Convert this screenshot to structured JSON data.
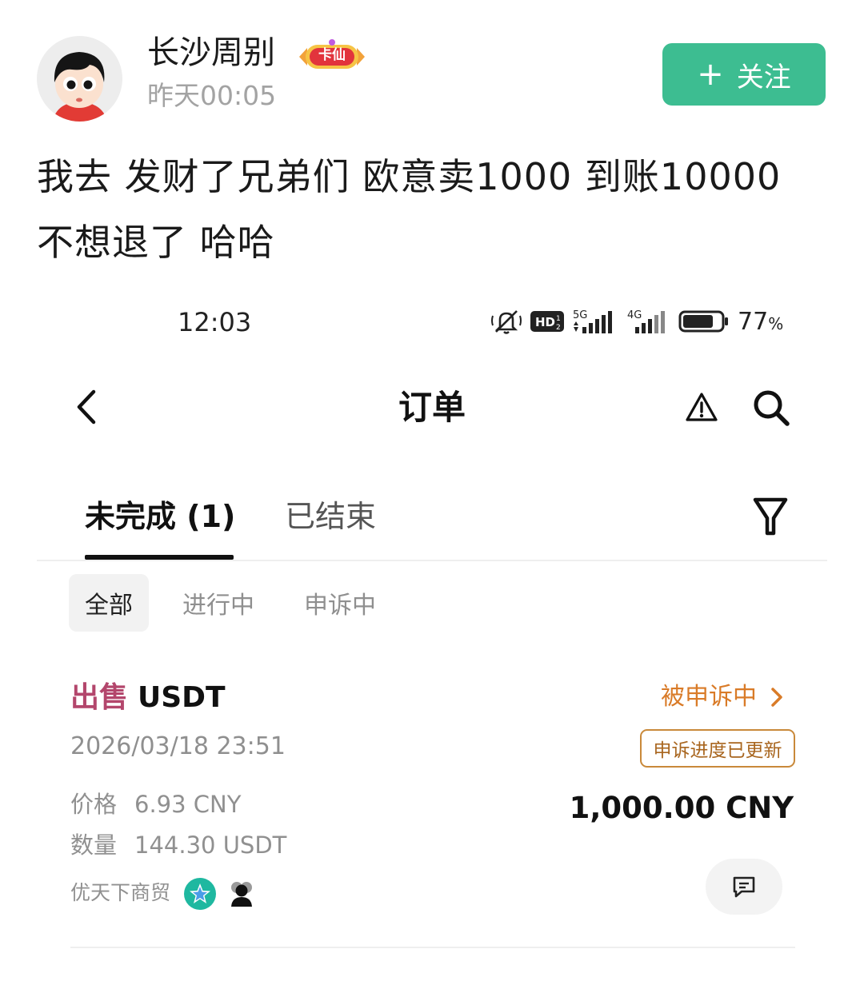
{
  "post": {
    "username": "长沙周别",
    "badge": "卡仙",
    "time": "昨天00:05",
    "follow_label": "关注",
    "follow_icon": "plus-icon",
    "text_lines": [
      "我去 发财了兄弟们 欧意卖1000 到账10000",
      "不想退了 哈哈"
    ]
  },
  "embedded_screen": {
    "status_bar": {
      "time": "12:03",
      "network_labels": [
        "HD",
        "5G",
        "4G"
      ],
      "battery_percent": "77",
      "battery_unit": "%",
      "battery_level": 0.77
    },
    "nav": {
      "title": "订单",
      "icons": [
        "back-icon",
        "alert-icon",
        "search-icon"
      ]
    },
    "tabs": {
      "active": "未完成 (1)",
      "inactive": "已结束"
    },
    "filters": [
      "全部",
      "进行中",
      "申诉中"
    ],
    "order": {
      "side": "出售",
      "asset": "USDT",
      "status": "被申诉中",
      "date": "2026/03/18 23:51",
      "appeal_tag": "申诉进度已更新",
      "price_label": "价格",
      "price_value": "6.93 CNY",
      "qty_label": "数量",
      "qty_value": "144.30 USDT",
      "amount": "1,000.00 CNY",
      "merchant": "优天下商贸"
    }
  },
  "colors": {
    "follow_button": "#3dbd91",
    "sell": "#b3466c",
    "status_orange": "#d97b28",
    "appeal_tag_border": "#c9893a"
  }
}
